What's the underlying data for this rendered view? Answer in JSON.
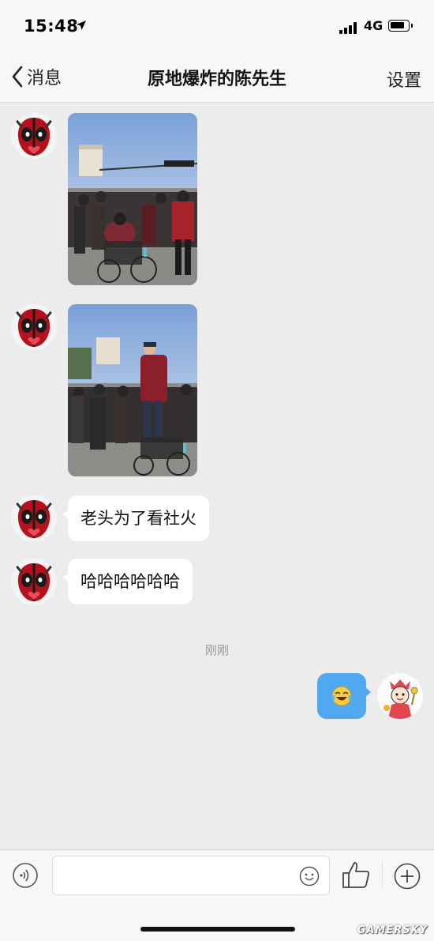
{
  "status_bar": {
    "time": "15:48",
    "network": "4G"
  },
  "nav": {
    "back_label": "消息",
    "title": "原地爆炸的陈先生",
    "settings_label": "设置"
  },
  "messages": [
    {
      "from": "contact",
      "type": "image"
    },
    {
      "from": "contact",
      "type": "image"
    },
    {
      "from": "contact",
      "type": "text",
      "text": "老头为了看社火"
    },
    {
      "from": "contact",
      "type": "text",
      "text": "哈哈哈哈哈哈"
    },
    {
      "from": "me",
      "type": "emoji",
      "emoji": "laughing-crying-emoji"
    }
  ],
  "timestamp": "刚刚",
  "input": {
    "value": "",
    "placeholder": ""
  },
  "watermark": "GAMERSKY",
  "colors": {
    "outgoing_bubble": "#50a8f0",
    "background": "#ececec"
  }
}
